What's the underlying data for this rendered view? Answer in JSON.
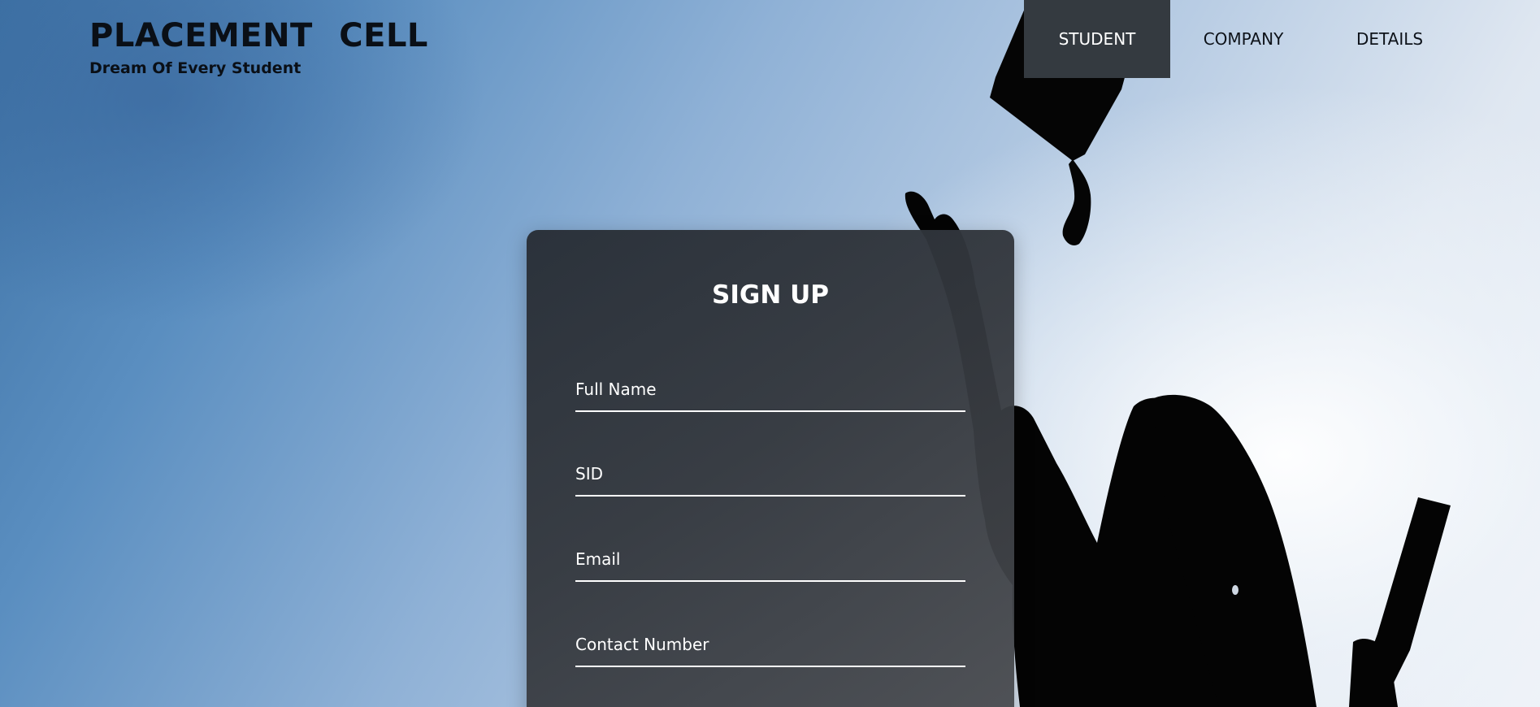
{
  "brand": {
    "title": "PLACEMENT CELL",
    "tagline": "Dream Of Every Student"
  },
  "nav": {
    "items": [
      {
        "label": "STUDENT",
        "active": true
      },
      {
        "label": "COMPANY",
        "active": false
      },
      {
        "label": "DETAILS",
        "active": false
      }
    ]
  },
  "form": {
    "title": "SIGN UP",
    "fields": [
      {
        "label": "Full Name",
        "value": ""
      },
      {
        "label": "SID",
        "value": ""
      },
      {
        "label": "Email",
        "value": ""
      },
      {
        "label": "Contact Number",
        "value": ""
      }
    ]
  },
  "colors": {
    "nav_active_bg": "#343a40",
    "card_bg": "#2f353c",
    "text_dark": "#0a0f16",
    "text_light": "#ffffff"
  }
}
